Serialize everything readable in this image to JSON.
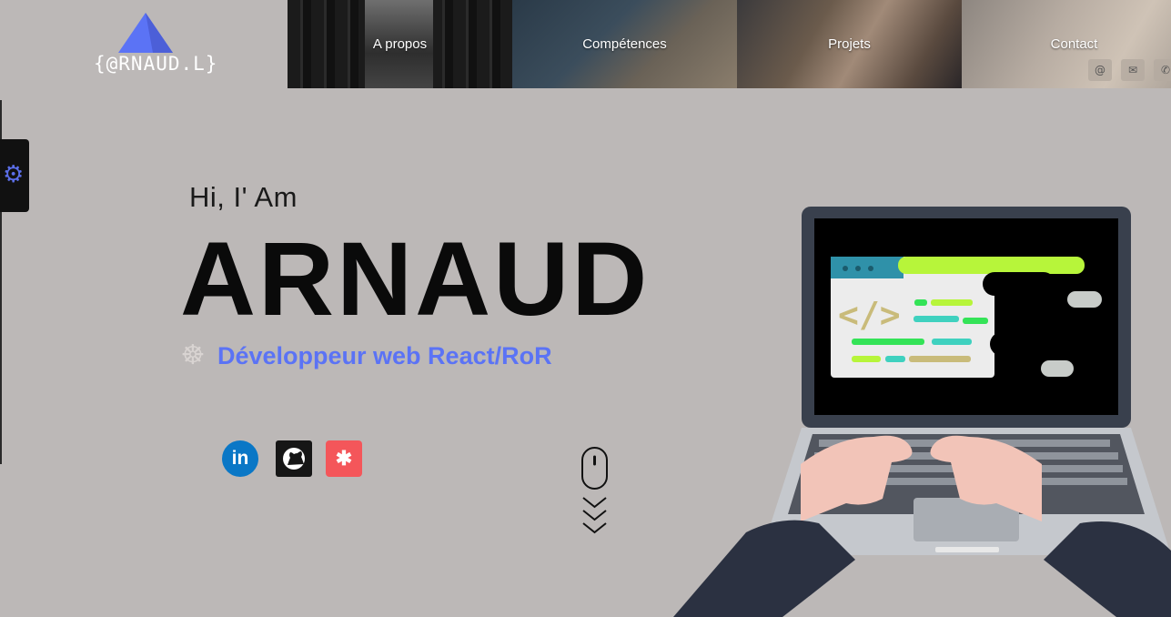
{
  "logo": {
    "text": "{@RNAUD.L}",
    "accent": "#5b6ee8"
  },
  "nav": {
    "items": [
      {
        "label": "A propos"
      },
      {
        "label": "Compétences"
      },
      {
        "label": "Projets"
      },
      {
        "label": "Contact"
      }
    ]
  },
  "contact_icons": [
    "@",
    "✉",
    "✆"
  ],
  "settings": {
    "icon": "gear-icon",
    "color": "#5b6ee8"
  },
  "hero": {
    "greeting": "Hi, I' Am",
    "name": "ARNAUD",
    "role": "Développeur web React/RoR",
    "role_color": "#5b73f5"
  },
  "socials": {
    "linkedin": "in",
    "malt": "✱"
  },
  "colors": {
    "background": "#bcb8b7",
    "linkedin": "#0a77c6",
    "github": "#161616",
    "malt": "#f4565a"
  }
}
